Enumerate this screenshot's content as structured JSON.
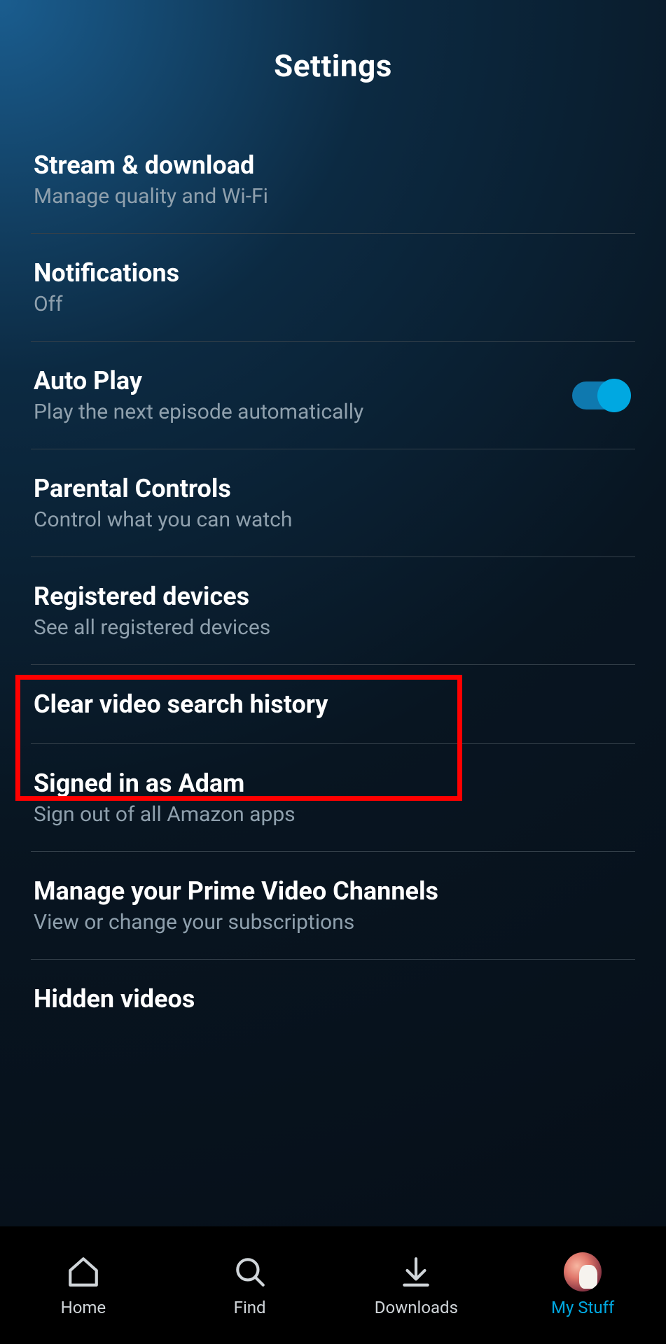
{
  "header": {
    "title": "Settings"
  },
  "items": [
    {
      "title": "Stream & download",
      "sub": "Manage quality and Wi-Fi"
    },
    {
      "title": "Notifications",
      "sub": "Off"
    },
    {
      "title": "Auto Play",
      "sub": "Play the next episode automatically",
      "toggle": true
    },
    {
      "title": "Parental Controls",
      "sub": "Control what you can watch"
    },
    {
      "title": "Registered devices",
      "sub": "See all registered devices"
    },
    {
      "title": "Clear video search history",
      "sub": ""
    },
    {
      "title": "Signed in as Adam",
      "sub": "Sign out of all Amazon apps"
    },
    {
      "title": "Manage your Prime Video Channels",
      "sub": "View or change your subscriptions"
    },
    {
      "title": "Hidden videos",
      "sub": ""
    }
  ],
  "nav": {
    "home": "Home",
    "find": "Find",
    "downloads": "Downloads",
    "mystuff": "My Stuff"
  }
}
